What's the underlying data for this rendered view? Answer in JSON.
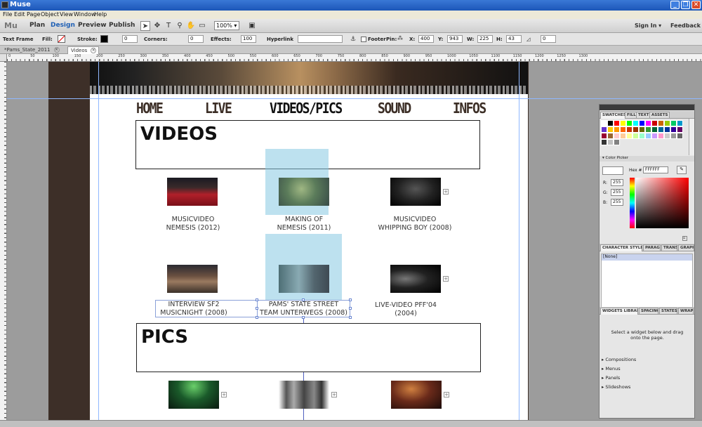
{
  "window": {
    "title": "Muse"
  },
  "menu": [
    "File",
    "Edit",
    "Page",
    "Object",
    "View",
    "Window",
    "Help"
  ],
  "modebar": {
    "logo": "Mu",
    "modes": [
      "Plan",
      "Design",
      "Preview",
      "Publish"
    ],
    "active_mode": "Design",
    "zoom": "100%",
    "sign_in": "Sign In ▾",
    "feedback": "Feedback"
  },
  "controlbar": {
    "selection_type": "Text Frame",
    "fill_label": "Fill:",
    "stroke_label": "Stroke:",
    "stroke_value": "0",
    "corners_label": "Corners:",
    "corners_value": "0",
    "effects_label": "Effects:",
    "effects_value": "100",
    "hyperlink_label": "Hyperlink",
    "footer_label": "Footer",
    "pin_label": "Pin:",
    "x_label": "X:",
    "x_value": "400",
    "y_label": "Y:",
    "y_value": "943",
    "w_label": "W:",
    "w_value": "225",
    "h_label": "H:",
    "h_value": "43",
    "angle_value": "0"
  },
  "tabs": [
    {
      "label": "*Pams_State_2011"
    },
    {
      "label": "Videos"
    }
  ],
  "ruler_ticks": [
    "0",
    "50",
    "100",
    "150",
    "200",
    "250",
    "300",
    "350",
    "400",
    "450",
    "500",
    "550",
    "600",
    "650",
    "700",
    "750",
    "800",
    "850",
    "900",
    "950",
    "1000",
    "1050",
    "1100",
    "1150",
    "1200",
    "1250",
    "1300"
  ],
  "site": {
    "nav": [
      "HOME",
      "LIVE",
      "VIDEOS/PICS",
      "SOUND",
      "INFOS"
    ],
    "active_nav": "VIDEOS/PICS",
    "videos_heading": "VIDEOS",
    "pics_heading": "PICS",
    "videos": [
      {
        "line1": "MUSICVIDEO",
        "line2": "NEMESIS (2012)"
      },
      {
        "line1": "MAKING OF",
        "line2": "NEMESIS (2011)"
      },
      {
        "line1": "MUSICVIDEO",
        "line2": "WHIPPING BOY (2008)"
      },
      {
        "line1": "INTERVIEW SF2",
        "line2": "MUSICNIGHT (2008)"
      },
      {
        "line1": "PAMS' STATE STREET",
        "line2": "TEAM UNTERWEGS (2008)"
      },
      {
        "line1": "LIVE-VIDEO PFF'04",
        "line2": "(2004)"
      }
    ]
  },
  "panel": {
    "swatch_tabs": [
      "SWATCHES",
      "FILL",
      "TEXT",
      "ASSETS"
    ],
    "color_picker_label": "Color Picker",
    "hex_label": "Hex #",
    "hex_value": "FFFFFF",
    "r_label": "R:",
    "r_value": "255",
    "g_label": "G:",
    "g_value": "255",
    "b_label": "B:",
    "b_value": "255",
    "char_tabs": [
      "CHARACTER STYLES",
      "PARAGRA",
      "TRANSF",
      "GRAPHI"
    ],
    "char_selected": "[None]",
    "widget_tabs": [
      "WIDGETS LIBRARY",
      "SPACING",
      "STATES",
      "WRAP"
    ],
    "widget_hint": "Select a widget below and drag onto the page.",
    "widget_groups": [
      "Compositions",
      "Menus",
      "Panels",
      "Slideshows"
    ],
    "swatch_colors": [
      "#ffffff",
      "#000000",
      "#ff0000",
      "#ffff00",
      "#00ff00",
      "#00ffff",
      "#0000ff",
      "#ff00ff",
      "#cc0000",
      "#cc6600",
      "#99cc00",
      "#00cc66",
      "#0099cc",
      "#6633cc",
      "#ffcc00",
      "#ff9900",
      "#ff6600",
      "#cc3300",
      "#993300",
      "#666600",
      "#339933",
      "#006633",
      "#006699",
      "#003399",
      "#330099",
      "#660066",
      "#990033",
      "#996633",
      "#ffcccc",
      "#ffcc99",
      "#ffff99",
      "#ccff99",
      "#99ffcc",
      "#99ccff",
      "#cc99ff",
      "#ff99cc",
      "#cccccc",
      "#999999",
      "#666666",
      "#333333",
      "#c0c0c0",
      "#808080"
    ]
  }
}
